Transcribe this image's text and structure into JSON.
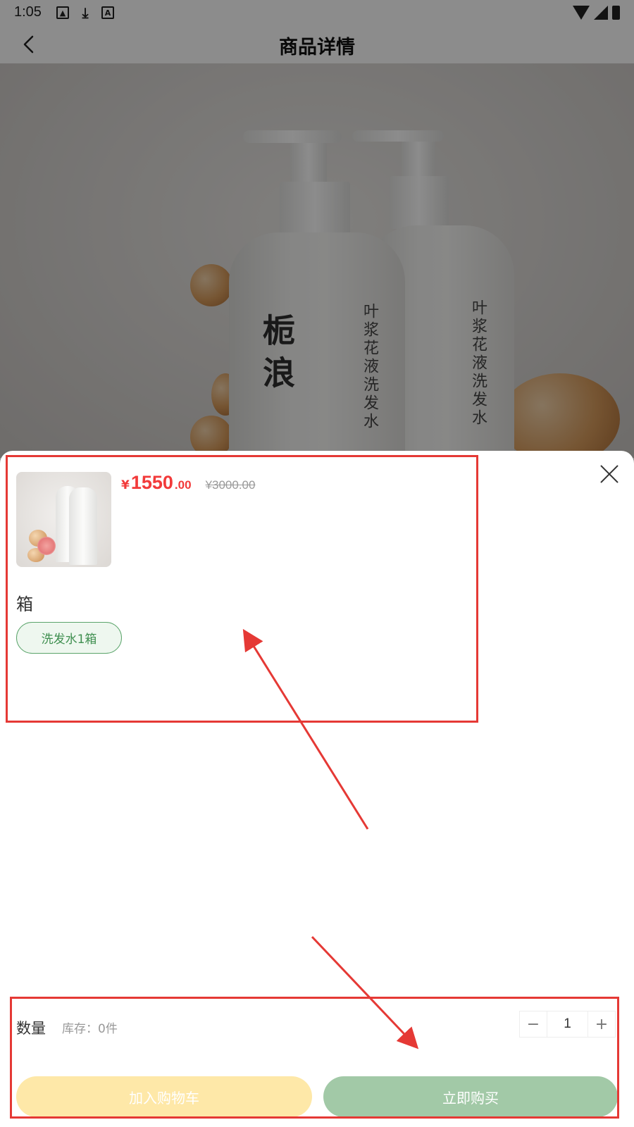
{
  "status_bar": {
    "time": "1:05",
    "left_icons": [
      "image-icon",
      "download-icon",
      "app-a-icon"
    ],
    "right_icons": [
      "wifi-icon",
      "signal-icon",
      "battery-icon"
    ]
  },
  "header": {
    "title": "商品详情",
    "back_icon": "chevron-left-icon"
  },
  "hero": {
    "brand": "栀浪",
    "product_vertical_text": "叶浆花液洗发水"
  },
  "sheet": {
    "price": {
      "symbol": "¥",
      "integer": "1550",
      "decimal": ".00",
      "original": "¥3000.00"
    },
    "spec_group_label": "箱",
    "spec_options": [
      {
        "label": "洗发水1箱",
        "selected": true
      }
    ],
    "quantity": {
      "label": "数量",
      "stock_text": "库存：0件",
      "value": "1",
      "minus": "−",
      "plus": "+"
    },
    "buttons": {
      "add_to_cart": "加入购物车",
      "buy_now": "立即购买"
    }
  },
  "colors": {
    "price_red": "#f23a3a",
    "chip_green": "#3f8f50",
    "cart_button": "#fee8a8",
    "buy_button": "#a2c9a7",
    "annotation_red": "#e53935"
  }
}
